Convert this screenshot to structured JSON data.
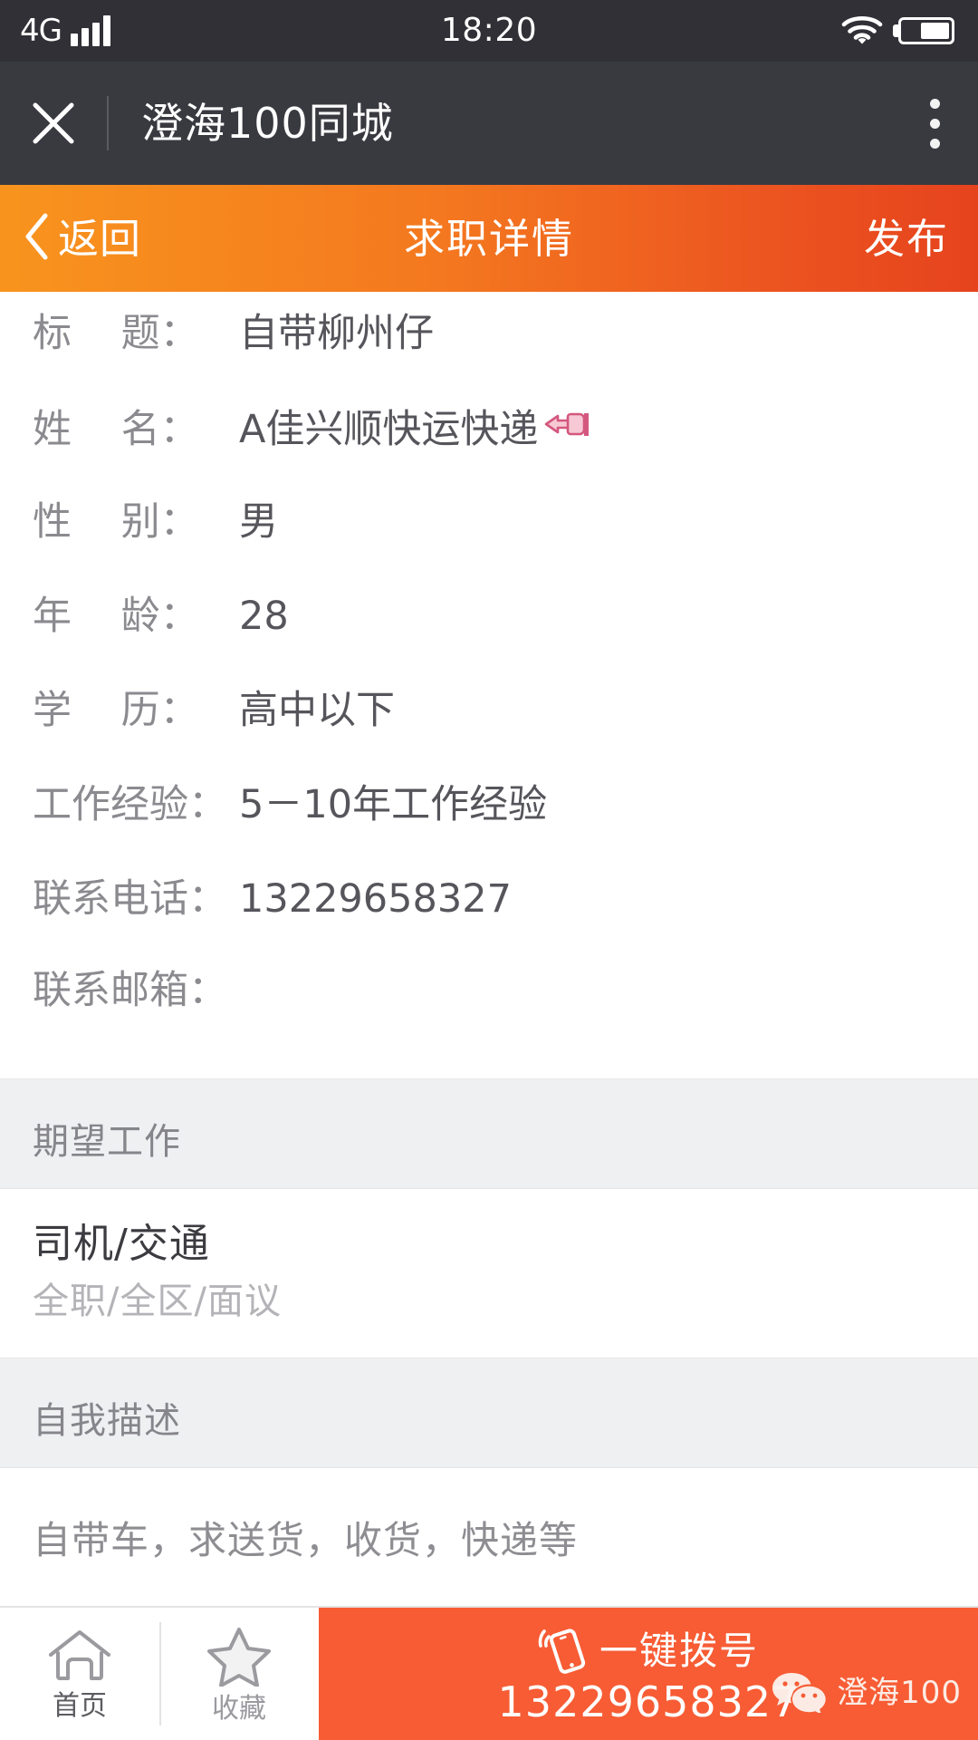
{
  "status_bar": {
    "network": "4G",
    "time": "18:20",
    "signal_icon": "signal-bars-icon",
    "wifi_icon": "wifi-icon",
    "battery_icon": "battery-icon",
    "battery_level_percent": 62
  },
  "wechat_header": {
    "close_icon": "close-icon",
    "title": "澄海100同城",
    "menu_icon": "more-options-icon"
  },
  "navbar": {
    "back_icon": "chevron-left-icon",
    "back_label": "返回",
    "title": "求职详情",
    "publish_label": "发布",
    "gradient_start": "#f8941e",
    "gradient_end": "#e6431d"
  },
  "info_rows": [
    {
      "label": "标    题：",
      "value": "自带柳州仔",
      "emoji": ""
    },
    {
      "label": "姓    名：",
      "value": "A佳兴顺快运快递",
      "emoji": "pointing-left-hand-emoji"
    },
    {
      "label": "性    别：",
      "value": "男",
      "emoji": ""
    },
    {
      "label": "年    龄：",
      "value": "28",
      "emoji": ""
    },
    {
      "label": "学    历：",
      "value": "高中以下",
      "emoji": ""
    },
    {
      "label": "工作经验：",
      "value": "5－10年工作经验",
      "emoji": ""
    },
    {
      "label": "联系电话：",
      "value": "13229658327",
      "emoji": ""
    },
    {
      "label": "联系邮箱：",
      "value": "",
      "emoji": ""
    }
  ],
  "expected_job": {
    "section_title": "期望工作",
    "title": "司机/交通",
    "subtitle": "全职/全区/面议"
  },
  "self_description": {
    "section_title": "自我描述",
    "text": "自带车，求送货，收货，快递等"
  },
  "bottom_bar": {
    "home": {
      "icon": "home-icon",
      "label": "首页"
    },
    "favorite": {
      "icon": "star-icon",
      "label": "收藏"
    },
    "call": {
      "icon": "phone-ringing-icon",
      "label": "一键拨号",
      "number": "13229658327",
      "color": "#f75c34"
    }
  },
  "watermark": {
    "icon": "wechat-logo-icon",
    "text": "澄海100"
  }
}
